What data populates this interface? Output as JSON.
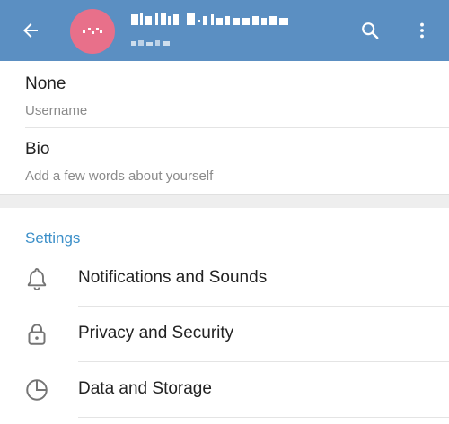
{
  "header": {
    "title": "Abhijit Kshirsagar",
    "subtitle": "online",
    "accent": "#5b8fc2"
  },
  "profile": {
    "username": {
      "value": "None",
      "label": "Username"
    },
    "bio": {
      "value": "Bio",
      "label": "Add a few words about yourself"
    }
  },
  "settings": {
    "title": "Settings",
    "items": [
      {
        "label": "Notifications and Sounds",
        "icon": "bell-icon"
      },
      {
        "label": "Privacy and Security",
        "icon": "lock-icon"
      },
      {
        "label": "Data and Storage",
        "icon": "clock-icon"
      }
    ]
  }
}
